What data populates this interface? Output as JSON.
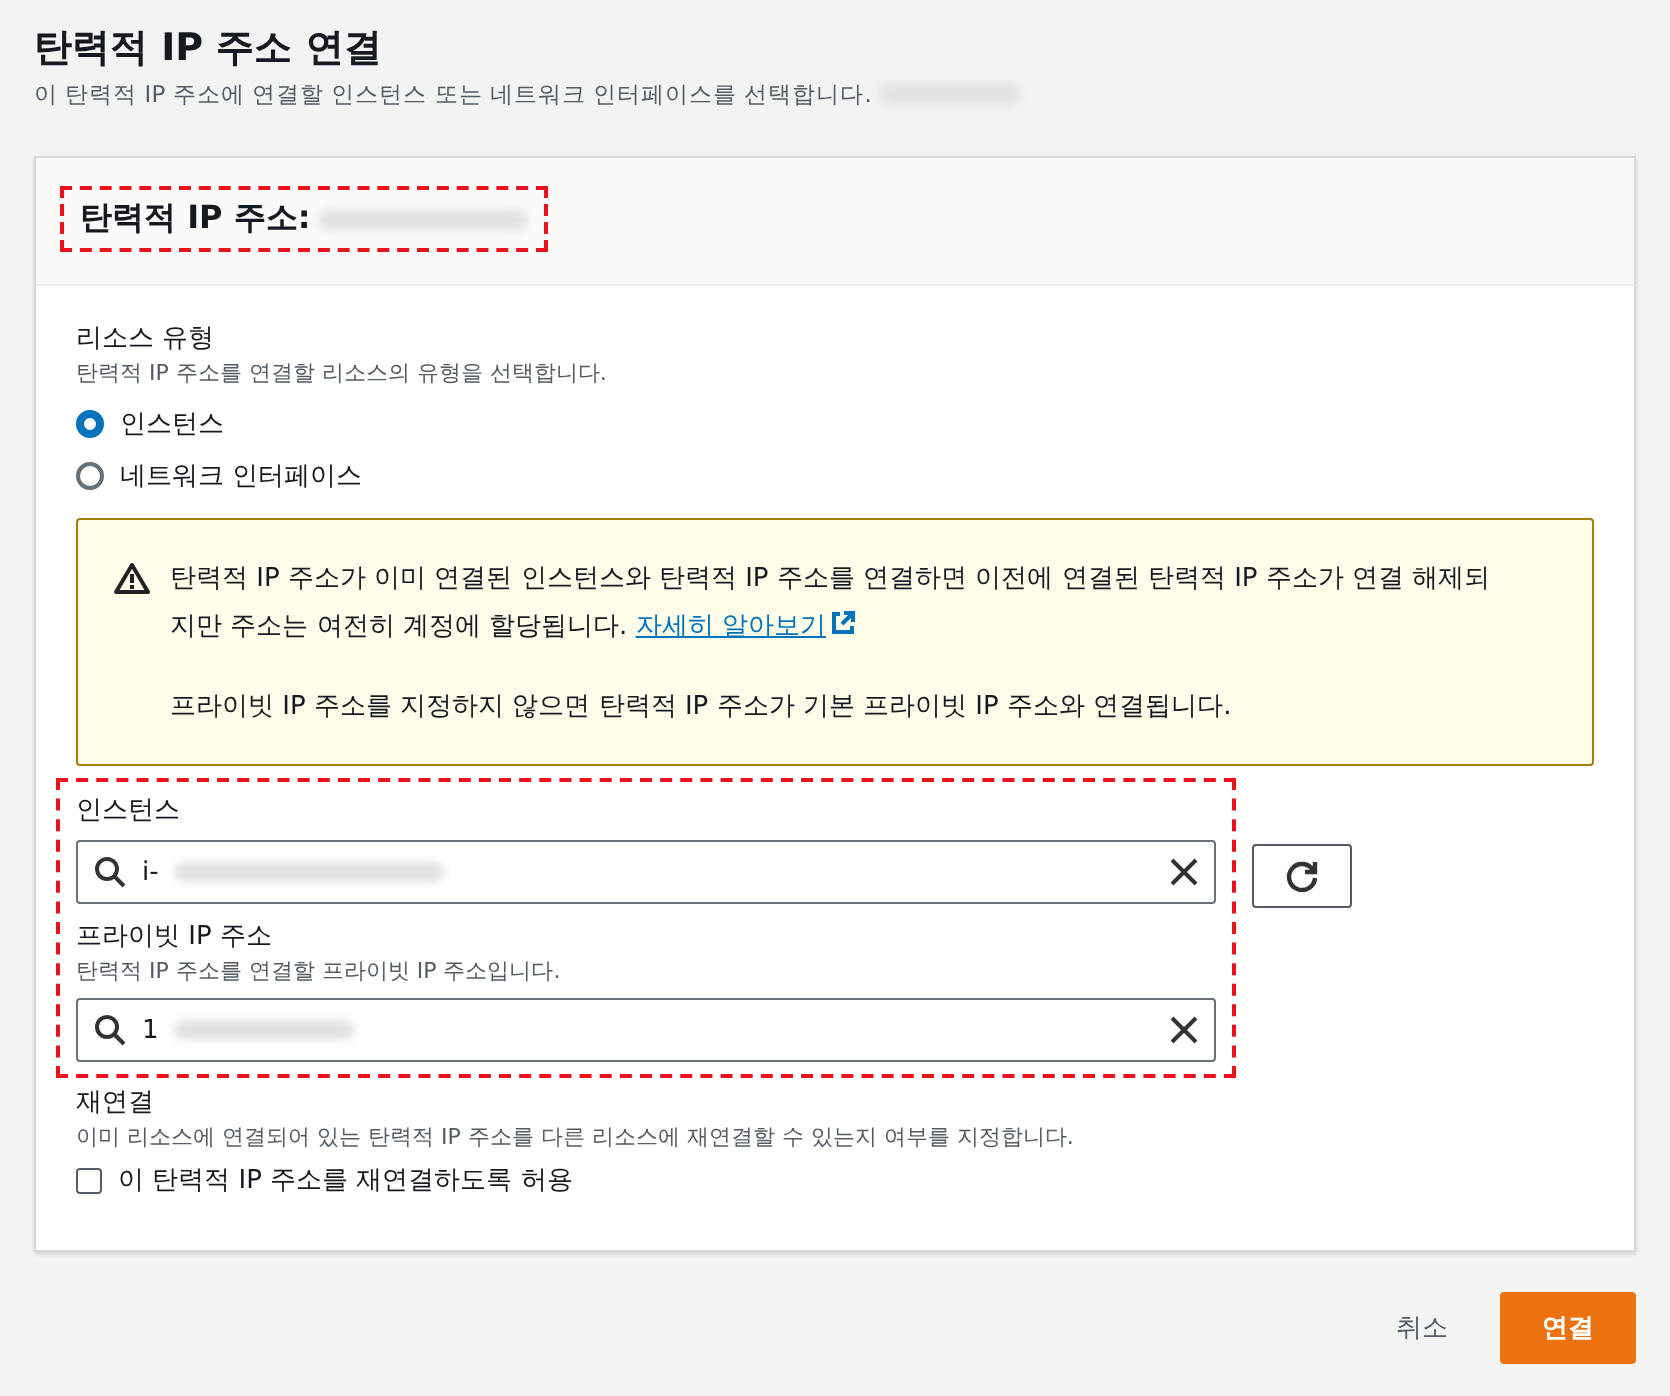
{
  "page": {
    "title": "탄력적 IP 주소 연결",
    "description": "이 탄력적 IP 주소에 연결할 인스턴스 또는 네트워크 인터페이스를 선택합니다."
  },
  "card": {
    "title": "탄력적 IP 주소:",
    "highlighted": true
  },
  "resource_type": {
    "label": "리소스 유형",
    "description": "탄력적 IP 주소를 연결할 리소스의 유형을 선택합니다.",
    "options": [
      {
        "label": "인스턴스",
        "selected": true
      },
      {
        "label": "네트워크 인터페이스",
        "selected": false
      }
    ]
  },
  "alert": {
    "text": "탄력적 IP 주소가 이미 연결된 인스턴스와 탄력적 IP 주소를 연결하면 이전에 연결된 탄력적 IP 주소가 연결 해제되지만 주소는 여전히 계정에 할당됩니다.",
    "link": "자세히 알아보기",
    "note": "프라이빗 IP 주소를 지정하지 않으면 탄력적 IP 주소가 기본 프라이빗 IP 주소와 연결됩니다."
  },
  "fields_highlighted": true,
  "instance": {
    "label": "인스턴스",
    "value": "i-"
  },
  "private_ip": {
    "label": "프라이빗 IP 주소",
    "description": "탄력적 IP 주소를 연결할 프라이빗 IP 주소입니다.",
    "value": "1"
  },
  "reassociation": {
    "label": "재연결",
    "description": "이미 리소스에 연결되어 있는 탄력적 IP 주소를 다른 리소스에 재연결할 수 있는지 여부를 지정합니다.",
    "checkbox": {
      "label": "이 탄력적 IP 주소를 재연결하도록 허용",
      "checked": false
    }
  },
  "buttons": [
    {
      "label": "취소",
      "kind": "link"
    },
    {
      "label": "연결",
      "kind": "primary"
    }
  ]
}
